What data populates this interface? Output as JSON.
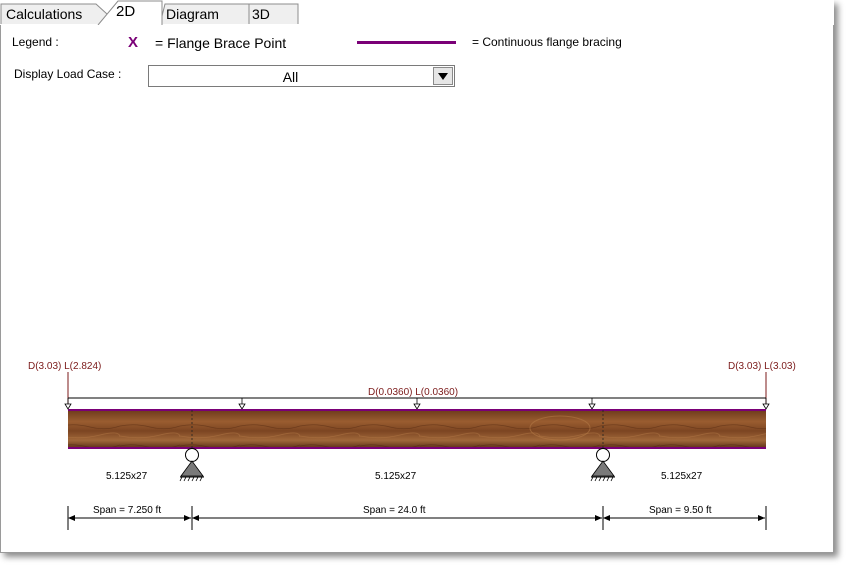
{
  "tabs": [
    {
      "label": "Calculations",
      "active": false
    },
    {
      "label": "2D",
      "active": true
    },
    {
      "label": "Diagram",
      "active": false
    },
    {
      "label": "3D",
      "active": false
    }
  ],
  "legend": {
    "title": "Legend :",
    "brace_symbol": "X",
    "brace_text": "= Flange Brace Point",
    "continuous_text": "= Continuous flange bracing",
    "brace_color": "#7a0077"
  },
  "load_case": {
    "label": "Display Load Case :",
    "value": "All"
  },
  "beam": {
    "loads": {
      "left_point": "D(3.03) L(2.824)",
      "right_point": "D(3.03) L(3.03)",
      "distributed": "D(0.0360) L(0.0360)"
    },
    "sections": [
      "5.125x27",
      "5.125x27",
      "5.125x27"
    ],
    "spans": [
      "Span = 7.250 ft",
      "Span = 24.0 ft",
      "Span = 9.50 ft"
    ],
    "load_color": "#7b1a1a",
    "bracing_color": "#7a0077",
    "wood_color": "#8a5128"
  }
}
